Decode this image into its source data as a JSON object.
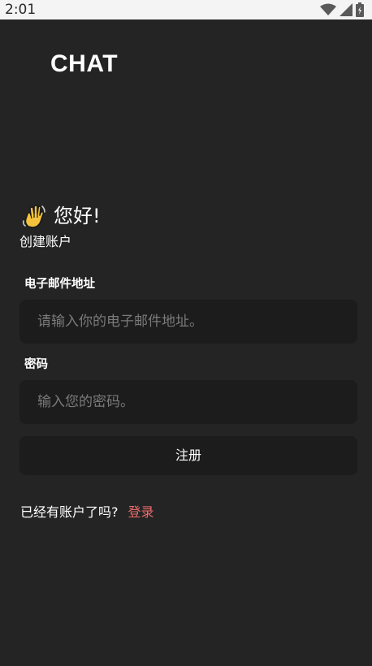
{
  "status_bar": {
    "time": "2:01",
    "icons": [
      "wifi-icon",
      "cellular-signal-icon",
      "battery-icon"
    ]
  },
  "brand": {
    "title": "CHAT"
  },
  "welcome": {
    "icon": "waving-hand-icon",
    "greeting": "您好!",
    "subtitle": "创建账户"
  },
  "form": {
    "email_label": "电子邮件地址",
    "email_value": "",
    "email_placeholder": "请输入你的电子邮件地址。",
    "password_label": "密码",
    "password_value": "",
    "password_placeholder": "输入您的密码。",
    "register_label": "注册"
  },
  "footer": {
    "prompt": "已经有账户了吗?",
    "login_label": "登录"
  },
  "colors": {
    "background": "#242424",
    "input_background": "#1c1c1c",
    "status_bar": "#f4f4f4",
    "link_accent": "#ec6a6a",
    "placeholder": "#7a7a7a",
    "wave_hand": "#f5c33b"
  }
}
